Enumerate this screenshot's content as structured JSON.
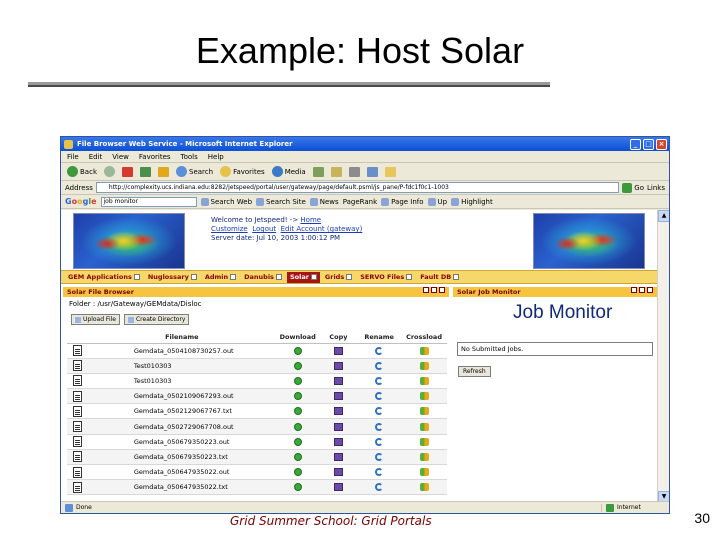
{
  "slide": {
    "title": "Example: Host Solar",
    "footer": "Grid Summer School: Grid Portals",
    "page_number": "30"
  },
  "browser": {
    "window_title": "File Browser Web Service - Microsoft Internet Explorer",
    "menu": [
      "File",
      "Edit",
      "View",
      "Favorites",
      "Tools",
      "Help"
    ],
    "toolbar": {
      "back": "Back",
      "search": "Search",
      "favorites": "Favorites",
      "media": "Media"
    },
    "address": {
      "label": "Address",
      "url": "http://complexity.ucs.indiana.edu:8282/jetspeed/portal/user/gateway/page/default.psml/js_pane/P-fdc1f0c1-1003",
      "go": "Go",
      "links": "Links"
    },
    "google": {
      "logo": [
        "G",
        "o",
        "o",
        "g",
        "l",
        "e"
      ],
      "query": "job monitor",
      "items": [
        "Search Web",
        "Search Site",
        "News",
        "PageRank",
        "Page Info",
        "Up",
        "Highlight"
      ]
    },
    "status": {
      "done": "Done",
      "zone": "Internet"
    }
  },
  "portal": {
    "welcome_line": "Welcome to Jetspeed! -> ",
    "home_link": "Home",
    "customize_link": "Customize",
    "logout_link": "Logout",
    "edit_account_link": "Edit Account (gateway)",
    "server_date": "Server date: Jul 10, 2003 1:00:12 PM",
    "tabs": [
      {
        "label": "GEM Applications",
        "active": false
      },
      {
        "label": "Nuglossary",
        "active": false
      },
      {
        "label": "Admin",
        "active": false
      },
      {
        "label": "Danubis",
        "active": false
      },
      {
        "label": "Solar",
        "active": true
      },
      {
        "label": "Grids",
        "active": false
      },
      {
        "label": "SERVO Files",
        "active": false
      },
      {
        "label": "Fault DB",
        "active": false
      }
    ],
    "file_browser": {
      "header": "Solar File Browser",
      "folder": "Folder : /usr/Gateway/GEMdata/Disloc",
      "buttons": [
        "Upload File",
        "Create Directory"
      ],
      "columns": [
        "Filename",
        "Download",
        "Copy",
        "Rename",
        "Crossload"
      ],
      "files": [
        "Gemdata_0504108730257.out",
        "Test010303",
        "Test010303",
        "Gemdata_0502109067293.out",
        "Gemdata_0502129067767.txt",
        "Gemdata_0502729067708.out",
        "Gemdata_050679350223.out",
        "Gemdata_050679350223.txt",
        "Gemdata_050647935022.out",
        "Gemdata_050647935022.txt"
      ]
    },
    "job_monitor": {
      "header": "Solar Job Monitor",
      "title": "Job Monitor",
      "status": "No Submitted Jobs.",
      "refresh": "Refresh"
    }
  }
}
